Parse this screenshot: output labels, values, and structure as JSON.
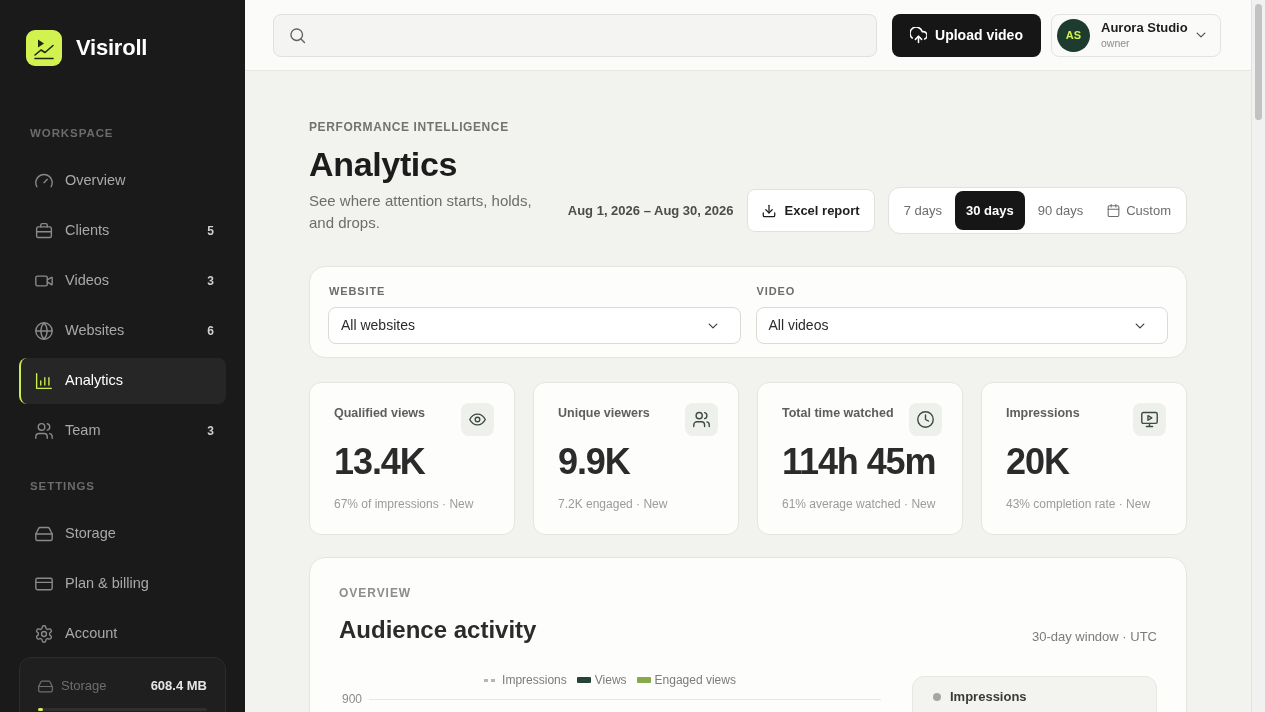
{
  "brand": {
    "name": "Visiroll"
  },
  "sidebar": {
    "sections": [
      {
        "heading": "WORKSPACE",
        "items": [
          {
            "label": "Overview",
            "selected": false
          },
          {
            "label": "Clients",
            "count": "5",
            "selected": false
          },
          {
            "label": "Videos",
            "count": "3",
            "selected": false
          },
          {
            "label": "Websites",
            "count": "6",
            "selected": false
          },
          {
            "label": "Analytics",
            "selected": true
          },
          {
            "label": "Team",
            "count": "3",
            "selected": false
          }
        ]
      },
      {
        "heading": "SETTINGS",
        "items": [
          {
            "label": "Storage",
            "selected": false
          },
          {
            "label": "Plan & billing",
            "selected": false
          },
          {
            "label": "Account",
            "selected": false
          }
        ]
      }
    ],
    "storage": {
      "label": "Storage",
      "value": "608.4 MB",
      "level": 0.03
    }
  },
  "topbar": {
    "upload_button": "Upload video",
    "account": {
      "initials": "AS",
      "name": "Aurora Studio",
      "role": "owner"
    }
  },
  "header": {
    "eyebrow": "PERFORMANCE INTELLIGENCE",
    "title": "Analytics",
    "description": "See where attention starts, holds, and drops.",
    "date_range": "Aug 1, 2026 – Aug 30, 2026",
    "export_button": "Excel report",
    "ranges": [
      {
        "label": "7 days",
        "kind": "preset",
        "selected": false
      },
      {
        "label": "30 days",
        "kind": "preset",
        "selected": true
      },
      {
        "label": "90 days",
        "kind": "preset",
        "selected": false
      },
      {
        "label": "Custom",
        "kind": "custom",
        "selected": false
      }
    ]
  },
  "filters": [
    {
      "label": "WEBSITE",
      "value": "All websites"
    },
    {
      "label": "VIDEO",
      "value": "All videos"
    }
  ],
  "metrics": [
    {
      "label": "Qualified views",
      "value": "13.4K",
      "note": "67% of impressions · New"
    },
    {
      "label": "Unique viewers",
      "value": "9.9K",
      "note": "7.2K engaged · New"
    },
    {
      "label": "Total time watched",
      "value": "114h 45m",
      "note": "61% average watched · New"
    },
    {
      "label": "Impressions",
      "value": "20K",
      "note": "43% completion rate · New"
    }
  ],
  "overview": {
    "eyebrow": "OVERVIEW",
    "title": "Audience activity",
    "window": "30-day window · UTC",
    "legend": [
      {
        "label": "Impressions",
        "kind": "dashed",
        "color": "#b4b8b0"
      },
      {
        "label": "Views",
        "kind": "solid",
        "color": "#26443a"
      },
      {
        "label": "Engaged views",
        "kind": "solid",
        "color": "#86ab48"
      }
    ],
    "y_tick_labels": [
      "900"
    ],
    "series_panel": [
      {
        "label": "Impressions",
        "color": "#a3a7a0"
      }
    ]
  }
}
